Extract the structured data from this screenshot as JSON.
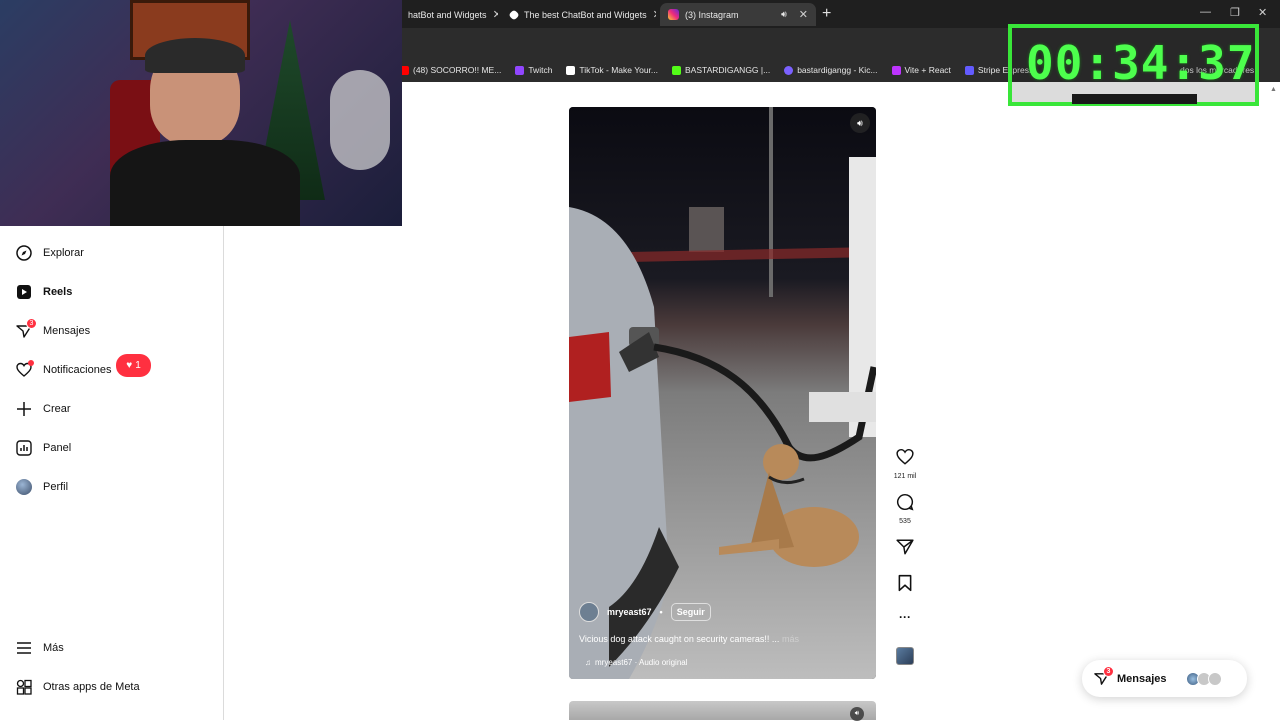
{
  "browser": {
    "tabs": [
      {
        "label": "hatBot and Widgets",
        "active": false
      },
      {
        "label": "The best ChatBot and Widgets",
        "active": false
      },
      {
        "label": "(3) Instagram",
        "active": true
      }
    ],
    "new_tab_label": "+",
    "bookmarks": [
      {
        "label": "(48) SOCORRO!! ME...",
        "color": "#ff0000"
      },
      {
        "label": "Twitch",
        "color": "#9146ff"
      },
      {
        "label": "TikTok - Make Your...",
        "color": "#ffffff"
      },
      {
        "label": "BASTARDIGANGG |...",
        "color": "#53fc18"
      },
      {
        "label": "bastardigangg - Kic...",
        "color": "#7b61ff"
      },
      {
        "label": "Vite + React",
        "color": "#bd34fe"
      },
      {
        "label": "Stripe Express",
        "color": "#635bff"
      },
      {
        "label": "dos los marcadores",
        "color": "#e0e0e0"
      }
    ]
  },
  "timer": {
    "text": "00:34:37",
    "color": "#4dff4d"
  },
  "sidebar": {
    "items": [
      {
        "label": "Explorar",
        "icon": "compass-icon"
      },
      {
        "label": "Reels",
        "icon": "reels-icon"
      },
      {
        "label": "Mensajes",
        "icon": "messenger-icon",
        "badge": "3"
      },
      {
        "label": "Notificaciones",
        "icon": "heart-icon"
      },
      {
        "label": "Crear",
        "icon": "plus-icon"
      },
      {
        "label": "Panel",
        "icon": "chart-icon"
      },
      {
        "label": "Perfil",
        "icon": "avatar-icon"
      },
      {
        "label": "Más",
        "icon": "menu-icon"
      },
      {
        "label": "Otras apps de Meta",
        "icon": "meta-apps-icon"
      }
    ],
    "notification_pill": "1"
  },
  "reel": {
    "username": "mryeast67",
    "separator": "•",
    "follow_label": "Seguir",
    "caption": "Vicious dog attack caught on security cameras!! ...",
    "more_label": "más",
    "audio": "mryeast67 · Audio original"
  },
  "actions": {
    "likes": "121 mil",
    "comments": "535"
  },
  "messages_float": {
    "label": "Mensajes",
    "badge": "3"
  }
}
